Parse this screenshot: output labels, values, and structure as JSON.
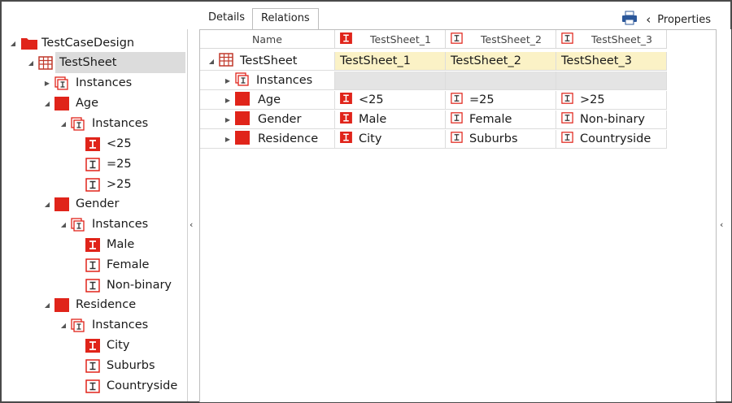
{
  "tabs": [
    {
      "label": "Details",
      "active": false
    },
    {
      "label": "Relations",
      "active": true
    }
  ],
  "toolbar": {
    "properties_label": "Properties",
    "print_icon": "printer-icon"
  },
  "colors": {
    "accent_red": "#e0241a",
    "selection": "#dcdcdc",
    "highlight_yellow": "#fbf2c6"
  },
  "tree": {
    "root": "TestCaseDesign",
    "sheet": "TestSheet",
    "instances_label": "Instances",
    "factors": [
      {
        "name": "Age",
        "instances_label": "Instances",
        "values": [
          "<25",
          "=25",
          ">25"
        ]
      },
      {
        "name": "Gender",
        "instances_label": "Instances",
        "values": [
          "Male",
          "Female",
          "Non-binary"
        ]
      },
      {
        "name": "Residence",
        "instances_label": "Instances",
        "values": [
          "City",
          "Suburbs",
          "Countryside"
        ]
      }
    ]
  },
  "grid": {
    "name_header": "Name",
    "columns": [
      "TestSheet_1",
      "TestSheet_2",
      "TestSheet_3"
    ],
    "top_row": {
      "label": "TestSheet",
      "values": [
        "TestSheet_1",
        "TestSheet_2",
        "TestSheet_3"
      ]
    },
    "rows": [
      {
        "label": "Instances",
        "values": [
          "",
          "",
          ""
        ]
      },
      {
        "label": "Age",
        "values": [
          "<25",
          "=25",
          ">25"
        ]
      },
      {
        "label": "Gender",
        "values": [
          "Male",
          "Female",
          "Non-binary"
        ]
      },
      {
        "label": "Residence",
        "values": [
          "City",
          "Suburbs",
          "Countryside"
        ]
      }
    ]
  }
}
